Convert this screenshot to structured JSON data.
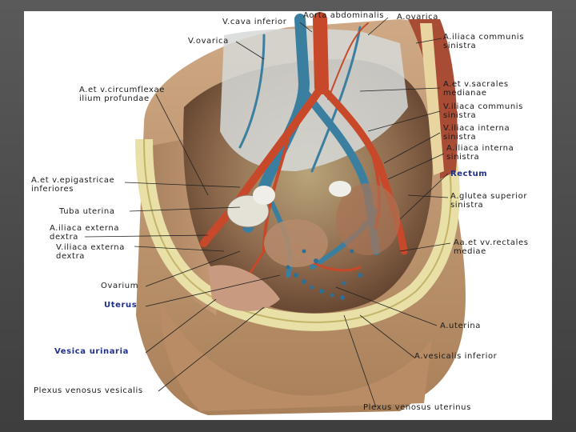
{
  "labels": {
    "v_cava_inferior": "V.cava inferior",
    "aorta_abdominalis": "Aorta abdominalis",
    "a_ovarica": "A.ovarica",
    "v_ovarica": "V.ovarica",
    "a_iliaca_communis_sinistra_1": "A.iliaca communis",
    "a_iliaca_communis_sinistra_2": "sinistra",
    "a_v_circumflexae_1": "A.et v.circumflexae",
    "a_v_circumflexae_2": "ilium profundae",
    "a_v_sacrales_1": "A.et v.sacrales",
    "a_v_sacrales_2": "medianae",
    "v_iliaca_communis_1": "V.iliaca communis",
    "v_iliaca_communis_2": "sinistra",
    "v_iliaca_interna_1": "V.iliaca interna",
    "v_iliaca_interna_2": "sinistra",
    "a_iliaca_interna_1": "A.iliaca interna",
    "a_iliaca_interna_2": "sinistra",
    "rectum": "Rectum",
    "a_v_epigastricae_1": "A.et v.epigastricae",
    "a_v_epigastricae_2": "inferiores",
    "a_glutea_1": "A.glutea superior",
    "a_glutea_2": "sinistra",
    "tuba_uterina": "Tuba uterina",
    "a_iliaca_externa_1": "A.iliaca externa",
    "a_iliaca_externa_2": "dextra",
    "v_iliaca_externa_1": "V.iliaca externa",
    "v_iliaca_externa_2": "dextra",
    "aa_vv_rectales_1": "Aa.et vv.rectales",
    "aa_vv_rectales_2": "mediae",
    "ovarium": "Ovarium",
    "uterus": "Uterus",
    "a_uterina": "A.uterina",
    "vesica_urinaria": "Vesica urinaria",
    "a_vesicalis_inferior": "A.vesicalis inferior",
    "plexus_venosus_vesicalis": "Plexus venosus vesicalis",
    "plexus_venosus_uterinus": "Plexus venosus uterinus"
  },
  "colors": {
    "artery": "#c8482a",
    "vein": "#3b7fa0",
    "skin": "#c9a27a",
    "bone": "#e8e0a6",
    "blue_label": "#1f2f8a"
  }
}
